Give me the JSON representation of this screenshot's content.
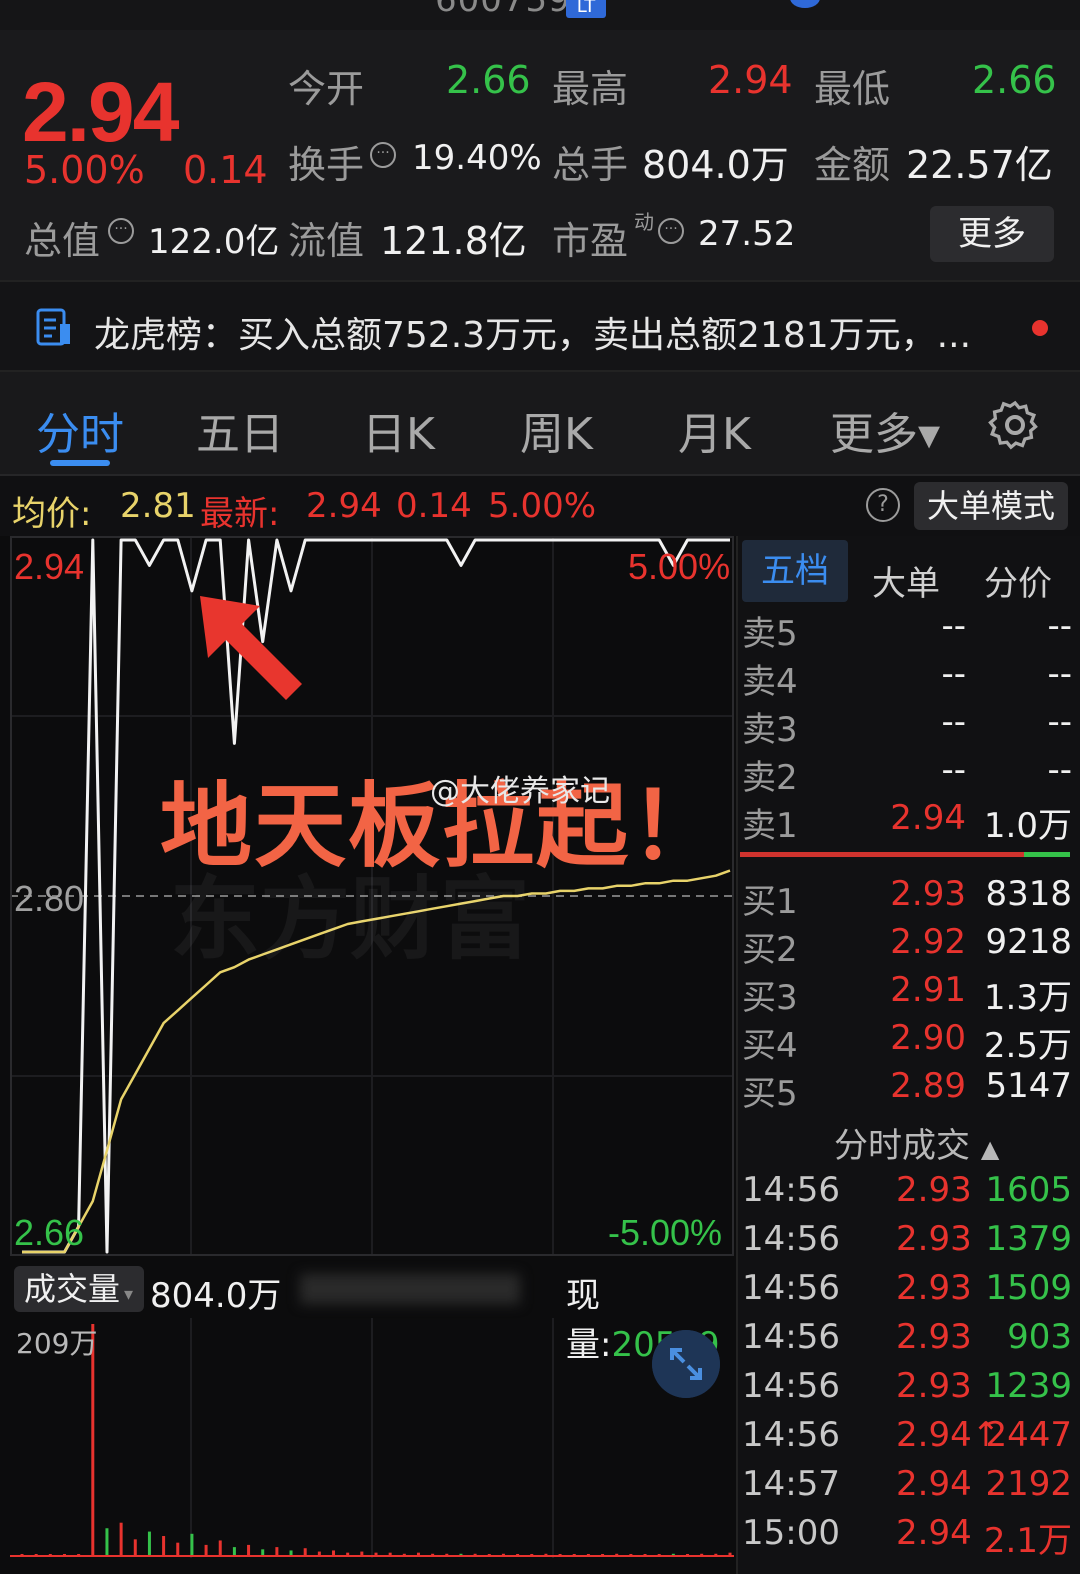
{
  "header": {
    "stock_code": "600759",
    "tag": "LT"
  },
  "quote": {
    "price": "2.94",
    "change_pct": "5.00%",
    "change_abs": "0.14",
    "open_label": "今开",
    "open": "2.66",
    "high_label": "最高",
    "high": "2.94",
    "low_label": "最低",
    "low": "2.66",
    "turnover_label": "换手",
    "turnover": "19.40%",
    "volume_label": "总手",
    "volume": "804.0万",
    "amount_label": "金额",
    "amount": "22.57亿",
    "mktcap_label": "总值",
    "mktcap": "122.0亿",
    "float_label": "流值",
    "float_cap": "121.8亿",
    "pe_label": "市盈",
    "pe_sup": "动",
    "pe": "27.52",
    "more_button": "更多"
  },
  "dragon_tiger": {
    "text": "龙虎榜：买入总额752.3万元，卖出总额2181万元，..."
  },
  "tabs": [
    "分时",
    "五日",
    "日K",
    "周K",
    "月K",
    "更多▾"
  ],
  "info_row": {
    "avg_label": "均价:",
    "avg": "2.81",
    "latest_label": "最新:",
    "latest": "2.94",
    "latest_chg": "0.14",
    "latest_pct": "5.00%",
    "help": "?",
    "big_order_mode": "大单模式"
  },
  "chart_labels": {
    "top_price": "2.94",
    "mid_price": "2.80",
    "bottom_price": "2.66",
    "top_pct": "5.00%",
    "bottom_pct": "-5.00%"
  },
  "annotation": "地天板拉起！",
  "watermark": "@大佬养家记",
  "volume_header": {
    "button": "成交量",
    "total": "804.0万",
    "current_label": "现量:",
    "current": "20529",
    "max": "209万"
  },
  "orderbook_tabs": [
    "五档",
    "大单",
    "分价"
  ],
  "orderbook": {
    "asks": [
      {
        "label": "卖5",
        "price": "--",
        "qty": "--"
      },
      {
        "label": "卖4",
        "price": "--",
        "qty": "--"
      },
      {
        "label": "卖3",
        "price": "--",
        "qty": "--"
      },
      {
        "label": "卖2",
        "price": "--",
        "qty": "--"
      },
      {
        "label": "卖1",
        "price": "2.94",
        "qty": "1.0万"
      }
    ],
    "bids": [
      {
        "label": "买1",
        "price": "2.93",
        "qty": "8318"
      },
      {
        "label": "买2",
        "price": "2.92",
        "qty": "9218"
      },
      {
        "label": "买3",
        "price": "2.91",
        "qty": "1.3万"
      },
      {
        "label": "买4",
        "price": "2.90",
        "qty": "2.5万"
      },
      {
        "label": "买5",
        "price": "2.89",
        "qty": "5147"
      }
    ]
  },
  "trades_title": "分时成交",
  "trades": [
    {
      "time": "14:56",
      "price": "2.93",
      "vol": "1605",
      "dir": "green"
    },
    {
      "time": "14:56",
      "price": "2.93",
      "vol": "1379",
      "dir": "green"
    },
    {
      "time": "14:56",
      "price": "2.93",
      "vol": "1509",
      "dir": "green"
    },
    {
      "time": "14:56",
      "price": "2.93",
      "vol": "903",
      "dir": "green"
    },
    {
      "time": "14:56",
      "price": "2.93",
      "vol": "1239",
      "dir": "green"
    },
    {
      "time": "14:56",
      "price": "2.94↑",
      "vol": "2447",
      "dir": "red"
    },
    {
      "time": "14:57",
      "price": "2.94",
      "vol": "2192",
      "dir": "red"
    },
    {
      "time": "15:00",
      "price": "2.94",
      "vol": "2.1万",
      "dir": "red"
    }
  ],
  "colors": {
    "up": "#e8332e",
    "down": "#35c24a",
    "accent": "#3b8df0",
    "avg_line": "#e8d36a",
    "annotation": "#f26445"
  },
  "chart_data": {
    "type": "line",
    "title": "",
    "xlabel": "",
    "ylabel": "",
    "ylim": [
      2.66,
      2.94
    ],
    "series": [
      {
        "name": "",
        "values": [
          2.66,
          2.66,
          2.66,
          2.66,
          2.67,
          2.94,
          2.66,
          2.94,
          2.94,
          2.93,
          2.94,
          2.94,
          2.92,
          2.94,
          2.94,
          2.86,
          2.94,
          2.9,
          2.94,
          2.92,
          2.94,
          2.94,
          2.94,
          2.94,
          2.94,
          2.94,
          2.94,
          2.94,
          2.94,
          2.94,
          2.94,
          2.93,
          2.94,
          2.94,
          2.94,
          2.94,
          2.94,
          2.94,
          2.94,
          2.94,
          2.94,
          2.94,
          2.94,
          2.94,
          2.94,
          2.94,
          2.93,
          2.94,
          2.94,
          2.94,
          2.94
        ]
      },
      {
        "name": "",
        "values": [
          2.66,
          2.66,
          2.66,
          2.66,
          2.67,
          2.68,
          2.7,
          2.72,
          2.73,
          2.74,
          2.75,
          2.755,
          2.76,
          2.765,
          2.77,
          2.772,
          2.775,
          2.777,
          2.779,
          2.781,
          2.783,
          2.785,
          2.787,
          2.789,
          2.79,
          2.791,
          2.792,
          2.793,
          2.794,
          2.795,
          2.796,
          2.797,
          2.798,
          2.799,
          2.8,
          2.8,
          2.801,
          2.801,
          2.802,
          2.802,
          2.803,
          2.803,
          2.804,
          2.804,
          2.805,
          2.805,
          2.806,
          2.806,
          2.807,
          2.808,
          2.81
        ]
      }
    ],
    "volume": {
      "ylim_label": "209万",
      "values": [
        0,
        0,
        0,
        0,
        0,
        2.09,
        0.25,
        0.3,
        0.15,
        0.22,
        0.18,
        0.12,
        0.2,
        0.1,
        0.14,
        0.08,
        0.1,
        0.06,
        0.08,
        0.05,
        0.07,
        0.04,
        0.05,
        0.03,
        0.04,
        0.03,
        0.03,
        0.02,
        0.03,
        0.02,
        0.02,
        0.02,
        0.02,
        0.01,
        0.02,
        0.01,
        0.01,
        0.02,
        0.01,
        0.01,
        0.01,
        0.01,
        0.02,
        0.01,
        0.01,
        0.01,
        0.02,
        0.01,
        0.02,
        0.02,
        0.03
      ]
    }
  }
}
